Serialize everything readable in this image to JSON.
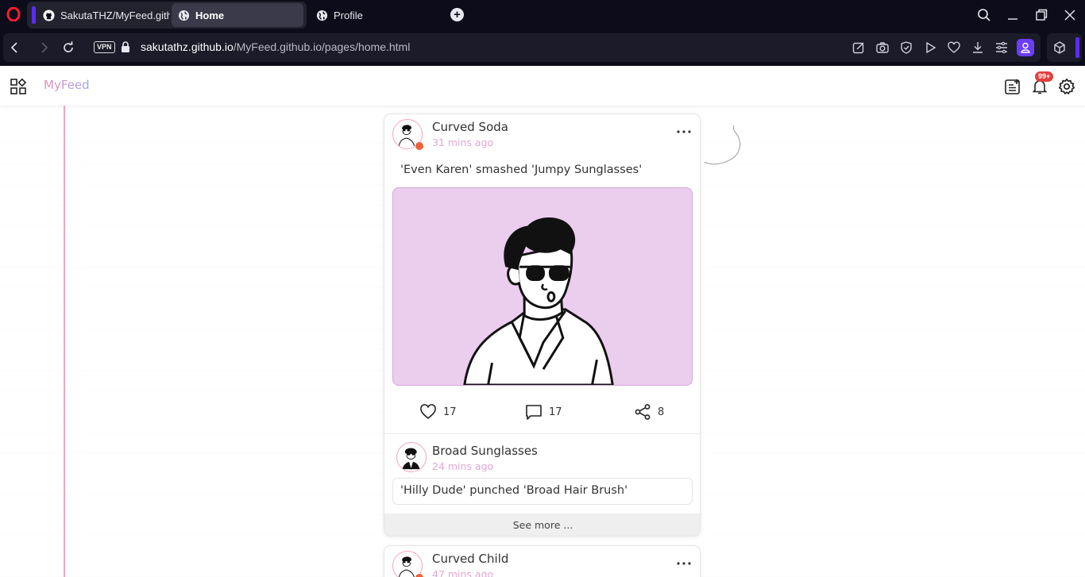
{
  "browser": {
    "tabs": [
      {
        "label": "SakutaTHZ/MyFeed.githu",
        "icon": "github-icon"
      },
      {
        "label": "Home",
        "icon": "globe-icon"
      },
      {
        "label": "Profile",
        "icon": "globe-icon"
      }
    ],
    "vpn_label": "VPN",
    "url_domain": "sakutathz.github.io",
    "url_path": "/MyFeed.github.io/pages/home.html"
  },
  "app": {
    "brand": "MyFeed",
    "notification_badge": "99+"
  },
  "posts": [
    {
      "author": "Curved Soda",
      "time": "31 mins ago",
      "caption": "'Even Karen' smashed 'Jumpy Sunglasses'",
      "likes": "17",
      "comments": "17",
      "shares": "8",
      "top_comment": {
        "author": "Broad Sunglasses",
        "time": "24 mins ago",
        "text": "'Hilly Dude' punched 'Broad Hair Brush'"
      },
      "see_more": "See more ..."
    },
    {
      "author": "Curved Child",
      "time": "47 mins ago"
    }
  ],
  "colors": {
    "accent_purple": "#5a2df0",
    "timeline_pink": "#f3a4c4",
    "image_bg": "#ebcdee",
    "online_dot": "#f0603a",
    "badge_red": "#e0403a"
  }
}
